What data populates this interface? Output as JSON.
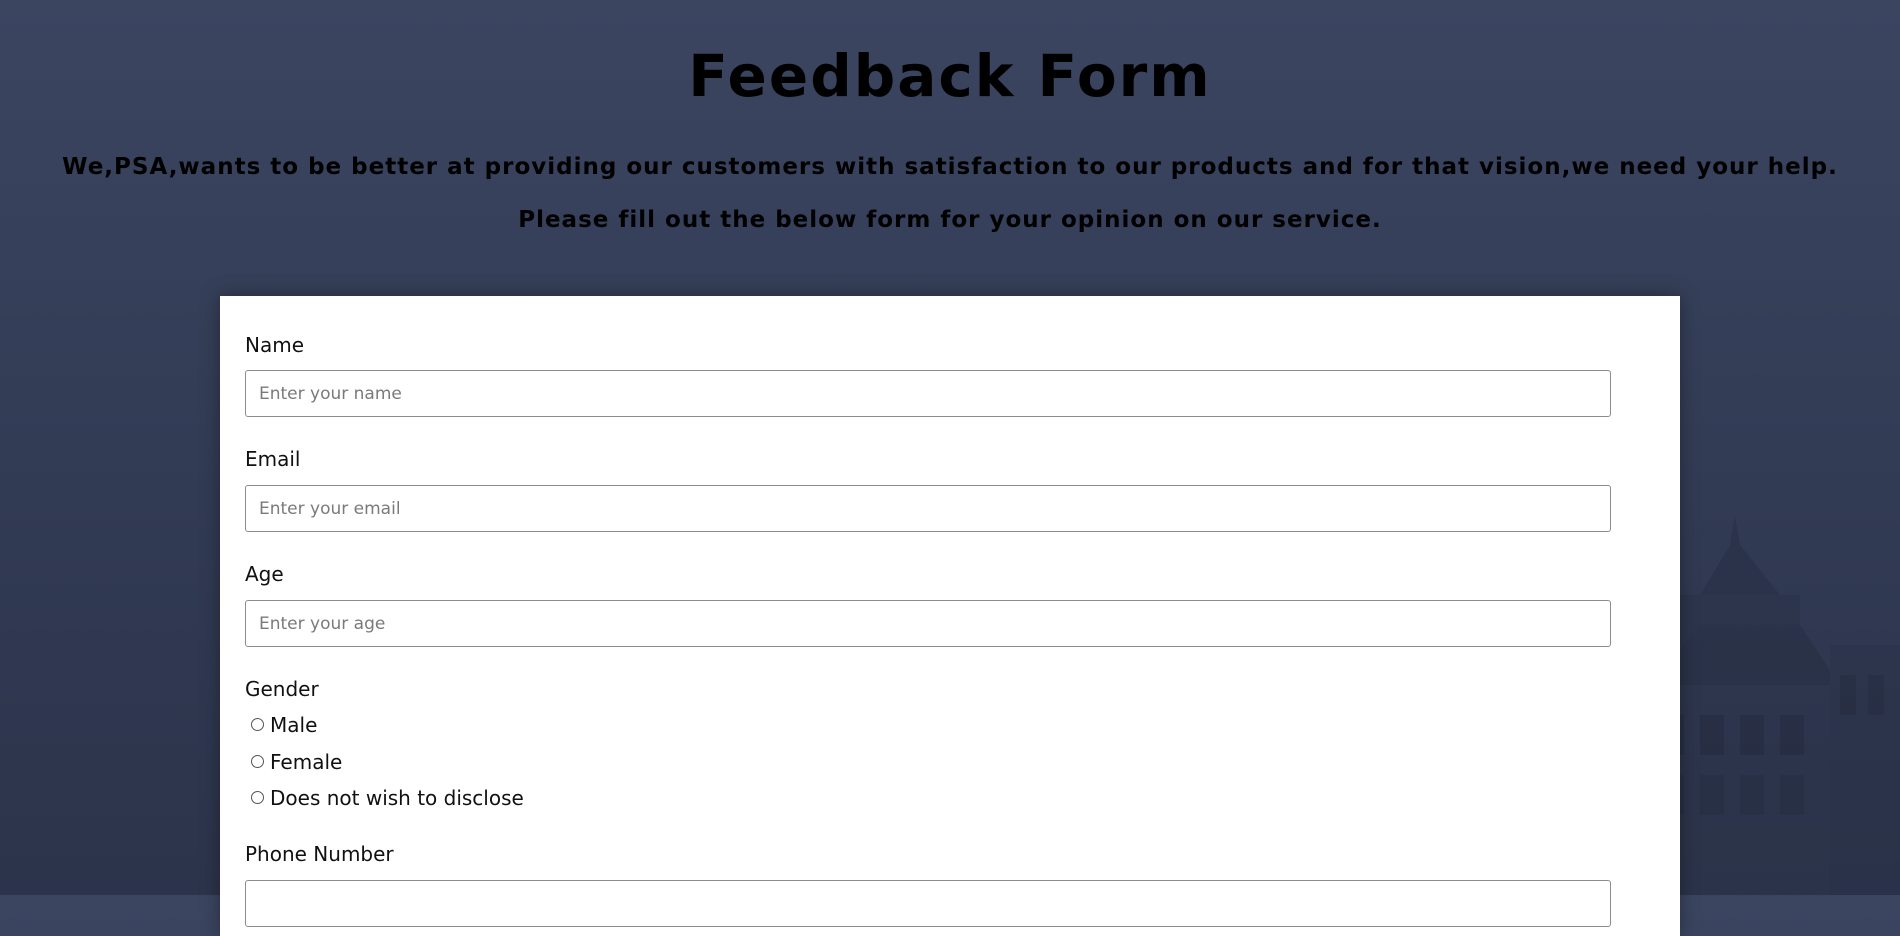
{
  "header": {
    "title": "Feedback Form",
    "intro_line_1": "We,PSA,wants to be better at providing our customers with satisfaction to our products and for that vision,we need your help.",
    "intro_line_2": "Please fill out the below form for your opinion on our service."
  },
  "form": {
    "name": {
      "label": "Name",
      "value": "",
      "placeholder": "Enter your name"
    },
    "email": {
      "label": "Email",
      "value": "",
      "placeholder": "Enter your email"
    },
    "age": {
      "label": "Age",
      "value": "",
      "placeholder": "Enter your age"
    },
    "gender": {
      "label": "Gender",
      "options": [
        "Male",
        "Female",
        "Does not wish to disclose"
      ],
      "selected": null
    },
    "phone": {
      "label": "Phone Number"
    }
  },
  "colors": {
    "background": "#363f58",
    "card": "#ffffff",
    "text": "#000000",
    "input_border": "#8c8c8c",
    "placeholder": "#7a7a7a"
  }
}
